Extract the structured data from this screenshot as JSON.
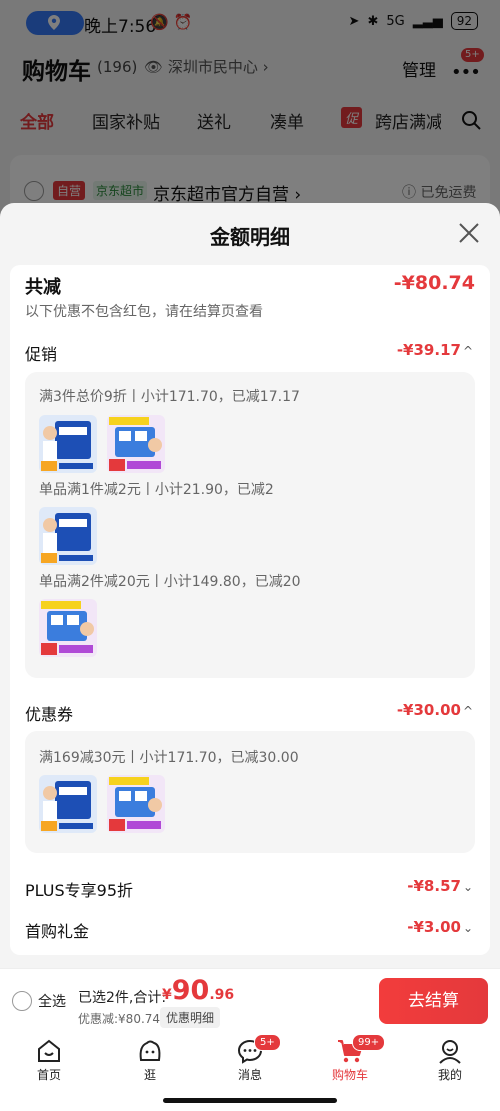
{
  "status_bar": {
    "time": "晚上7:56",
    "network": "5G",
    "battery": "92"
  },
  "header": {
    "title": "购物车",
    "count": "(196)",
    "location": "深圳市民中心",
    "manage": "管理",
    "badge": "5+"
  },
  "tabs": [
    {
      "label": "全部"
    },
    {
      "label": "国家补贴"
    },
    {
      "label": "送礼"
    },
    {
      "label": "凑单"
    },
    {
      "label": "跨店满减"
    }
  ],
  "promo_tag": "促",
  "shop": {
    "self_tag": "自营",
    "jd_tag": "京东超市",
    "name": "京东超市官方自营",
    "shipping": "已免运费"
  },
  "modal": {
    "title": "金额明细",
    "total_label": "共减",
    "total_value": "-¥80.74",
    "note": "以下优惠不包含红包，请在结算页查看",
    "promotion": {
      "label": "促销",
      "value": "-¥39.17",
      "rules": [
        "满3件总价9折丨小计171.70，已减17.17",
        "单品满1件减2元丨小计21.90，已减2",
        "单品满2件减20元丨小计149.80，已减20"
      ]
    },
    "coupon": {
      "label": "优惠券",
      "value": "-¥30.00",
      "rules": [
        "满169减30元丨小计171.70，已减30.00"
      ]
    },
    "plus": {
      "label": "PLUS专享95折",
      "value": "-¥8.57"
    },
    "first_gift": {
      "label": "首购礼金",
      "value": "-¥3.00"
    }
  },
  "bottom_bar": {
    "select_all": "全选",
    "selected_info": "已选2件,合计:",
    "price_currency": "¥",
    "price_int": "90",
    "price_dec": ".96",
    "saved": "优惠减:¥80.74",
    "detail_link": "优惠明细",
    "checkout": "去结算"
  },
  "tabbar": [
    {
      "label": "首页",
      "icon": "home-icon"
    },
    {
      "label": "逛",
      "icon": "face-icon"
    },
    {
      "label": "消息",
      "icon": "message-icon",
      "badge": "5+"
    },
    {
      "label": "购物车",
      "icon": "cart-icon",
      "badge": "99+",
      "active": true
    },
    {
      "label": "我的",
      "icon": "user-icon"
    }
  ],
  "colors": {
    "accent": "#e4393c",
    "location_pill": "#3478f6"
  }
}
